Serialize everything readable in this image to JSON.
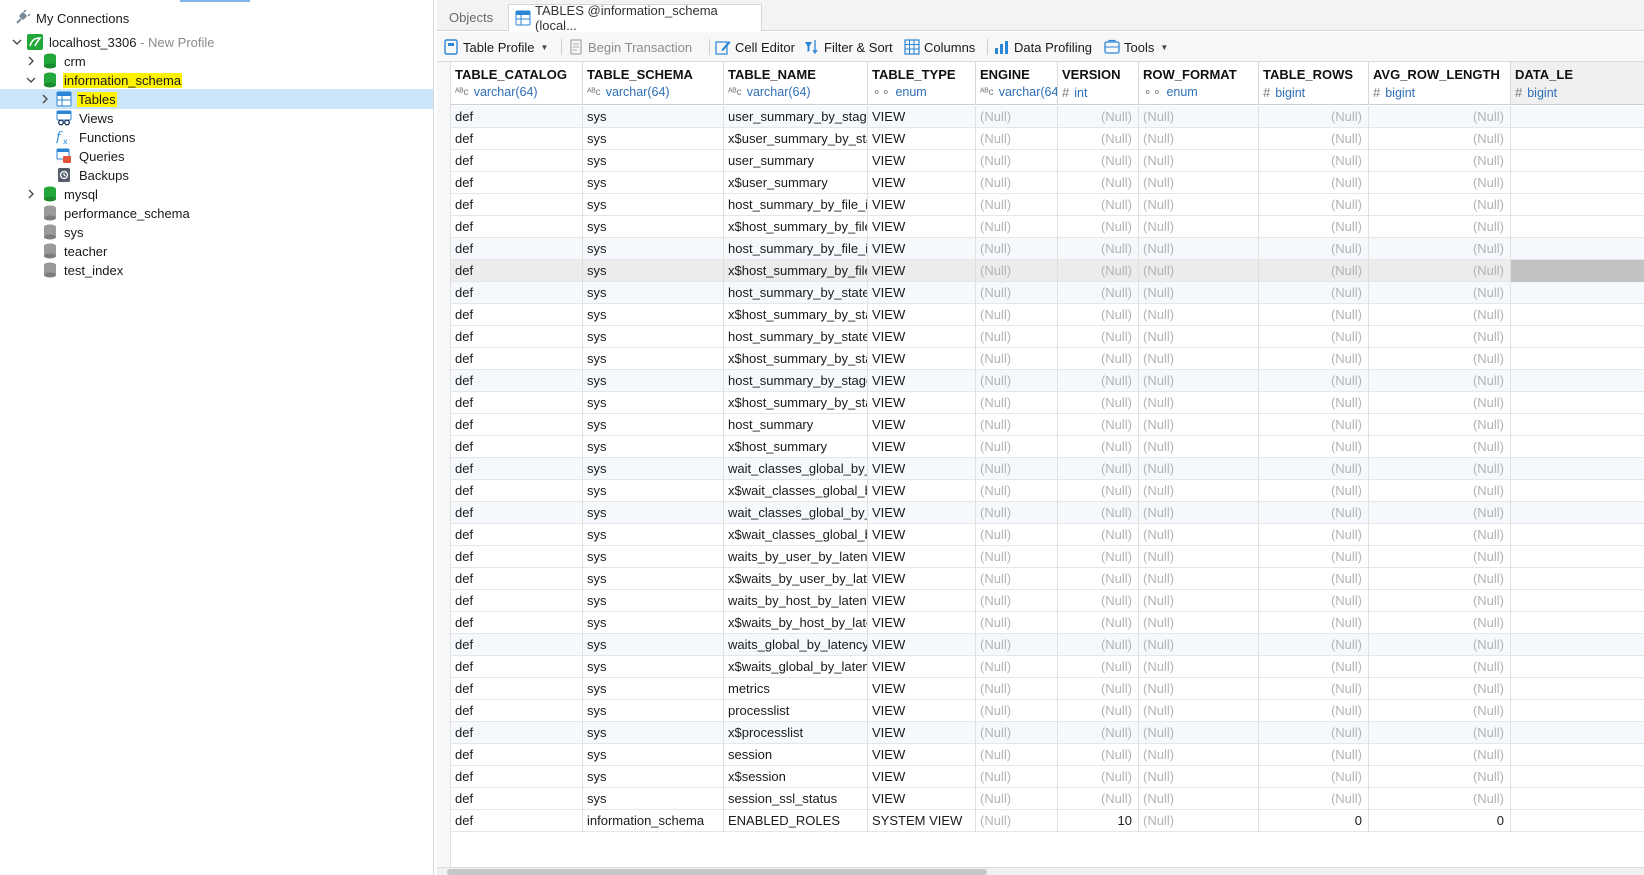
{
  "sidebar": {
    "root_label": "My Connections",
    "connection": {
      "name": "localhost_3306",
      "profile": "- New Profile"
    },
    "databases": [
      {
        "name": "crm",
        "state": "collapsed",
        "color": "#22a83a"
      },
      {
        "name": "information_schema",
        "state": "expanded",
        "color": "#22a83a",
        "highlighted": true
      },
      {
        "name": "mysql",
        "state": "collapsed",
        "color": "#22a83a"
      },
      {
        "name": "performance_schema",
        "state": "none",
        "color": "#8c8c8c"
      },
      {
        "name": "sys",
        "state": "none",
        "color": "#8c8c8c"
      },
      {
        "name": "teacher",
        "state": "none",
        "color": "#8c8c8c"
      },
      {
        "name": "test_index",
        "state": "none",
        "color": "#8c8c8c"
      }
    ],
    "schema_children": [
      {
        "name": "Tables",
        "icon": "table-icon",
        "selected": true,
        "highlighted": true
      },
      {
        "name": "Views",
        "icon": "view-icon"
      },
      {
        "name": "Functions",
        "icon": "function-icon"
      },
      {
        "name": "Queries",
        "icon": "query-icon"
      },
      {
        "name": "Backups",
        "icon": "backup-icon"
      }
    ]
  },
  "tabs": {
    "objects": "Objects",
    "active": "TABLES @information_schema (local..."
  },
  "toolbar": {
    "table_profile": "Table Profile",
    "begin_transaction": "Begin Transaction",
    "cell_editor": "Cell Editor",
    "filter_sort": "Filter & Sort",
    "columns": "Columns",
    "data_profiling": "Data Profiling",
    "tools": "Tools"
  },
  "grid": {
    "columns": [
      {
        "name": "TABLE_CATALOG",
        "type": "varchar(64)",
        "symbol": "ABC"
      },
      {
        "name": "TABLE_SCHEMA",
        "type": "varchar(64)",
        "symbol": "ABC"
      },
      {
        "name": "TABLE_NAME",
        "type": "varchar(64)",
        "symbol": "ABC"
      },
      {
        "name": "TABLE_TYPE",
        "type": "enum",
        "symbol": "enum"
      },
      {
        "name": "ENGINE",
        "type": "varchar(64)",
        "symbol": "ABC"
      },
      {
        "name": "VERSION",
        "type": "int",
        "symbol": "#"
      },
      {
        "name": "ROW_FORMAT",
        "type": "enum",
        "symbol": "enum"
      },
      {
        "name": "TABLE_ROWS",
        "type": "bigint",
        "symbol": "#"
      },
      {
        "name": "AVG_ROW_LENGTH",
        "type": "bigint",
        "symbol": "#"
      },
      {
        "name": "DATA_LE",
        "type": "bigint",
        "symbol": "#"
      }
    ],
    "null_text": "(Null)",
    "rows": [
      [
        "def",
        "sys",
        "user_summary_by_stage",
        "VIEW",
        "(Null)",
        "(Null)",
        "(Null)",
        "(Null)",
        "(Null)",
        ""
      ],
      [
        "def",
        "sys",
        "x$user_summary_by_stag",
        "VIEW",
        "(Null)",
        "(Null)",
        "(Null)",
        "(Null)",
        "(Null)",
        ""
      ],
      [
        "def",
        "sys",
        "user_summary",
        "VIEW",
        "(Null)",
        "(Null)",
        "(Null)",
        "(Null)",
        "(Null)",
        ""
      ],
      [
        "def",
        "sys",
        "x$user_summary",
        "VIEW",
        "(Null)",
        "(Null)",
        "(Null)",
        "(Null)",
        "(Null)",
        ""
      ],
      [
        "def",
        "sys",
        "host_summary_by_file_io",
        "VIEW",
        "(Null)",
        "(Null)",
        "(Null)",
        "(Null)",
        "(Null)",
        ""
      ],
      [
        "def",
        "sys",
        "x$host_summary_by_file_",
        "VIEW",
        "(Null)",
        "(Null)",
        "(Null)",
        "(Null)",
        "(Null)",
        ""
      ],
      [
        "def",
        "sys",
        "host_summary_by_file_io",
        "VIEW",
        "(Null)",
        "(Null)",
        "(Null)",
        "(Null)",
        "(Null)",
        ""
      ],
      [
        "def",
        "sys",
        "x$host_summary_by_file_",
        "VIEW",
        "(Null)",
        "(Null)",
        "(Null)",
        "(Null)",
        "(Null)",
        ""
      ],
      [
        "def",
        "sys",
        "host_summary_by_stater",
        "VIEW",
        "(Null)",
        "(Null)",
        "(Null)",
        "(Null)",
        "(Null)",
        ""
      ],
      [
        "def",
        "sys",
        "x$host_summary_by_stat",
        "VIEW",
        "(Null)",
        "(Null)",
        "(Null)",
        "(Null)",
        "(Null)",
        ""
      ],
      [
        "def",
        "sys",
        "host_summary_by_stater",
        "VIEW",
        "(Null)",
        "(Null)",
        "(Null)",
        "(Null)",
        "(Null)",
        ""
      ],
      [
        "def",
        "sys",
        "x$host_summary_by_stat",
        "VIEW",
        "(Null)",
        "(Null)",
        "(Null)",
        "(Null)",
        "(Null)",
        ""
      ],
      [
        "def",
        "sys",
        "host_summary_by_stage",
        "VIEW",
        "(Null)",
        "(Null)",
        "(Null)",
        "(Null)",
        "(Null)",
        ""
      ],
      [
        "def",
        "sys",
        "x$host_summary_by_stag",
        "VIEW",
        "(Null)",
        "(Null)",
        "(Null)",
        "(Null)",
        "(Null)",
        ""
      ],
      [
        "def",
        "sys",
        "host_summary",
        "VIEW",
        "(Null)",
        "(Null)",
        "(Null)",
        "(Null)",
        "(Null)",
        ""
      ],
      [
        "def",
        "sys",
        "x$host_summary",
        "VIEW",
        "(Null)",
        "(Null)",
        "(Null)",
        "(Null)",
        "(Null)",
        ""
      ],
      [
        "def",
        "sys",
        "wait_classes_global_by_a",
        "VIEW",
        "(Null)",
        "(Null)",
        "(Null)",
        "(Null)",
        "(Null)",
        ""
      ],
      [
        "def",
        "sys",
        "x$wait_classes_global_by",
        "VIEW",
        "(Null)",
        "(Null)",
        "(Null)",
        "(Null)",
        "(Null)",
        ""
      ],
      [
        "def",
        "sys",
        "wait_classes_global_by_l",
        "VIEW",
        "(Null)",
        "(Null)",
        "(Null)",
        "(Null)",
        "(Null)",
        ""
      ],
      [
        "def",
        "sys",
        "x$wait_classes_global_by",
        "VIEW",
        "(Null)",
        "(Null)",
        "(Null)",
        "(Null)",
        "(Null)",
        ""
      ],
      [
        "def",
        "sys",
        "waits_by_user_by_latency",
        "VIEW",
        "(Null)",
        "(Null)",
        "(Null)",
        "(Null)",
        "(Null)",
        ""
      ],
      [
        "def",
        "sys",
        "x$waits_by_user_by_later",
        "VIEW",
        "(Null)",
        "(Null)",
        "(Null)",
        "(Null)",
        "(Null)",
        ""
      ],
      [
        "def",
        "sys",
        "waits_by_host_by_latency",
        "VIEW",
        "(Null)",
        "(Null)",
        "(Null)",
        "(Null)",
        "(Null)",
        ""
      ],
      [
        "def",
        "sys",
        "x$waits_by_host_by_later",
        "VIEW",
        "(Null)",
        "(Null)",
        "(Null)",
        "(Null)",
        "(Null)",
        ""
      ],
      [
        "def",
        "sys",
        "waits_global_by_latency",
        "VIEW",
        "(Null)",
        "(Null)",
        "(Null)",
        "(Null)",
        "(Null)",
        ""
      ],
      [
        "def",
        "sys",
        "x$waits_global_by_latenc",
        "VIEW",
        "(Null)",
        "(Null)",
        "(Null)",
        "(Null)",
        "(Null)",
        ""
      ],
      [
        "def",
        "sys",
        "metrics",
        "VIEW",
        "(Null)",
        "(Null)",
        "(Null)",
        "(Null)",
        "(Null)",
        ""
      ],
      [
        "def",
        "sys",
        "processlist",
        "VIEW",
        "(Null)",
        "(Null)",
        "(Null)",
        "(Null)",
        "(Null)",
        ""
      ],
      [
        "def",
        "sys",
        "x$processlist",
        "VIEW",
        "(Null)",
        "(Null)",
        "(Null)",
        "(Null)",
        "(Null)",
        ""
      ],
      [
        "def",
        "sys",
        "session",
        "VIEW",
        "(Null)",
        "(Null)",
        "(Null)",
        "(Null)",
        "(Null)",
        ""
      ],
      [
        "def",
        "sys",
        "x$session",
        "VIEW",
        "(Null)",
        "(Null)",
        "(Null)",
        "(Null)",
        "(Null)",
        ""
      ],
      [
        "def",
        "sys",
        "session_ssl_status",
        "VIEW",
        "(Null)",
        "(Null)",
        "(Null)",
        "(Null)",
        "(Null)",
        ""
      ],
      [
        "def",
        "information_schema",
        "ENABLED_ROLES",
        "SYSTEM VIEW",
        "(Null)",
        "10",
        "(Null)",
        "0",
        "0",
        ""
      ]
    ],
    "selected_row": 7,
    "alt_rows": [
      0,
      6,
      8,
      12,
      16,
      18,
      24,
      28
    ]
  },
  "colors": {
    "highlight": "#fff200",
    "selection": "#cce4f7",
    "null_text": "#b3b3b3",
    "type_text": "#2e6fb5"
  }
}
